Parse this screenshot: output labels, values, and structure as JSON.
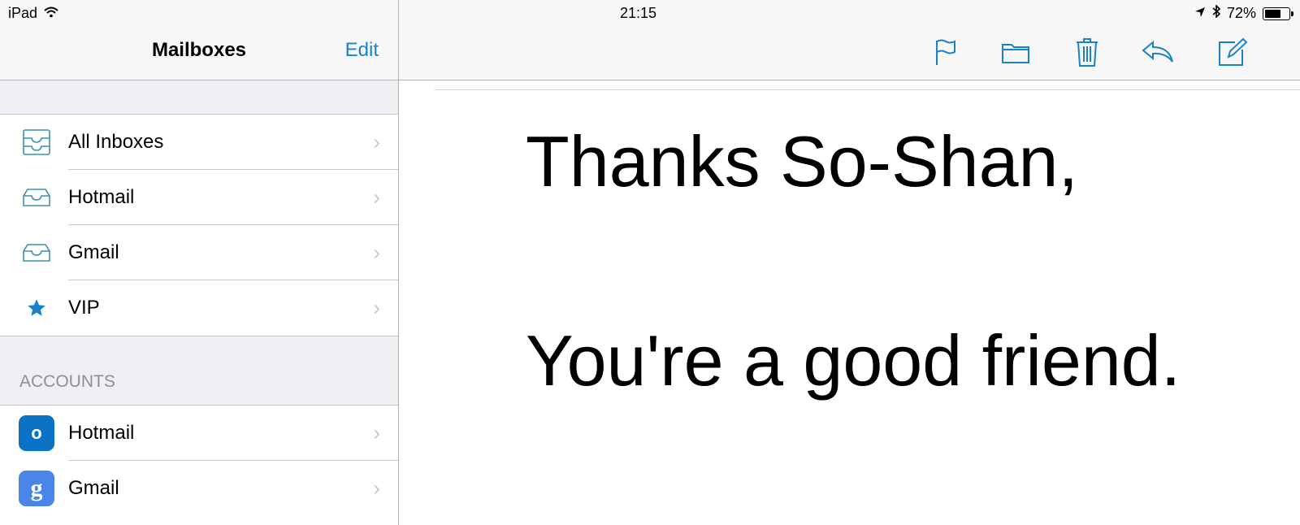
{
  "status_bar": {
    "device": "iPad",
    "time": "21:15",
    "battery": "72%",
    "battery_level": 0.72
  },
  "sidebar": {
    "title": "Mailboxes",
    "edit_label": "Edit",
    "mailboxes": [
      {
        "label": "All Inboxes",
        "icon": "all-inboxes-icon"
      },
      {
        "label": "Hotmail",
        "icon": "inbox-tray-icon"
      },
      {
        "label": "Gmail",
        "icon": "inbox-tray-icon"
      },
      {
        "label": "VIP",
        "icon": "star-icon"
      }
    ],
    "accounts_header": "ACCOUNTS",
    "accounts": [
      {
        "label": "Hotmail",
        "icon": "outlook-logo-icon",
        "glyph": "o"
      },
      {
        "label": "Gmail",
        "icon": "google-logo-icon",
        "glyph": "g"
      }
    ]
  },
  "toolbar": {
    "icons": [
      "flag-icon",
      "folder-icon",
      "trash-icon",
      "reply-icon",
      "compose-icon"
    ]
  },
  "message": {
    "line1": "Thanks So-Shan,",
    "line2": "You're a good friend."
  },
  "colors": {
    "accent": "#1a83c7",
    "separator": "#c8c7cc",
    "grouped_background": "#efeff4"
  }
}
